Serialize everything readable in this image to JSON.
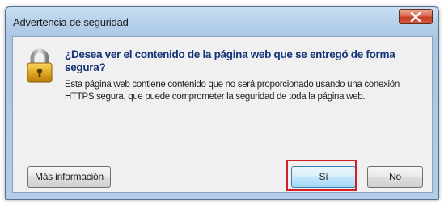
{
  "window": {
    "title": "Advertencia de seguridad",
    "close_icon": "close-icon"
  },
  "content": {
    "icon": "lock-icon",
    "question": "¿Desea ver el contenido de la página web que se entregó de forma segura?",
    "description": "Esta página web contiene contenido que no será proporcionado usando una conexión HTTPS segura, que puede comprometer la seguridad de toda la página web."
  },
  "buttons": {
    "more_info": "Más información",
    "yes": "Sí",
    "no": "No"
  },
  "annotation": {
    "highlight_color": "#d0202a"
  }
}
